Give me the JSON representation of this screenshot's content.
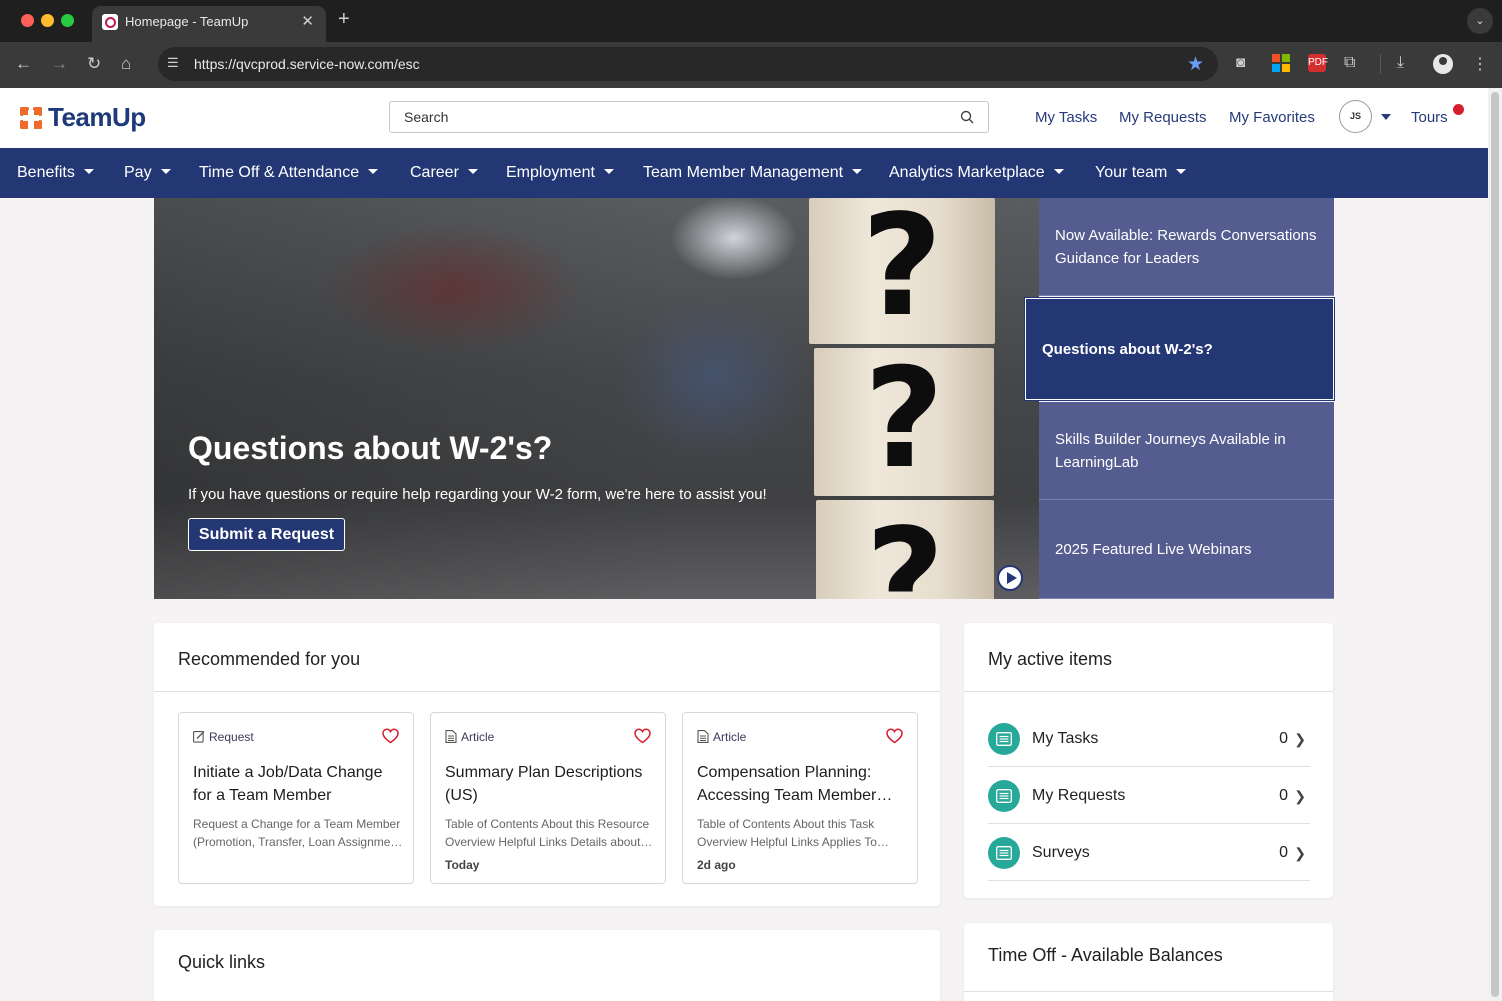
{
  "browser": {
    "tab_title": "Homepage - TeamUp",
    "tab_close": "✕",
    "new_tab": "+",
    "url": "https://qvcprod.service-now.com/esc",
    "pdf_ext_label": "PDF"
  },
  "header": {
    "logo_text": "TeamUp",
    "search_placeholder": "Search",
    "links": {
      "my_tasks": "My Tasks",
      "my_requests": "My Requests",
      "my_favorites": "My Favorites",
      "tours": "Tours"
    },
    "avatar_initials": "JS"
  },
  "nav": {
    "items": [
      "Benefits",
      "Pay",
      "Time Off & Attendance",
      "Career",
      "Employment",
      "Team Member Management",
      "Analytics Marketplace",
      "Your team"
    ]
  },
  "hero": {
    "question_mark": "?",
    "title": "Questions about W-2's?",
    "subtitle": "If you have questions or require help regarding your W-2 form, we're here to assist you!",
    "button_label": "Submit a Request"
  },
  "carousel": {
    "items": [
      "Now Available: Rewards Conversations Guidance for Leaders",
      "Questions about W-2's?",
      "Skills Builder Journeys Available in LearningLab",
      "2025 Featured Live Webinars"
    ],
    "active_index": 1
  },
  "recommended": {
    "title": "Recommended for you",
    "cards": [
      {
        "type": "Request",
        "title": "Initiate a Job/Data Change for a Team Member",
        "desc_line1": "Request a Change for a Team Member",
        "desc_line2": "(Promotion, Transfer, Loan Assignme…",
        "date": ""
      },
      {
        "type": "Article",
        "title": "Summary Plan Descriptions (US)",
        "desc_line1": "Table of Contents About this Resource",
        "desc_line2": "Overview Helpful Links Details about…",
        "date": "Today"
      },
      {
        "type": "Article",
        "title": "Compensation Planning: Accessing Team Member…",
        "desc_line1": "Table of Contents About this Task",
        "desc_line2": "Overview Helpful Links Applies To…",
        "date": "2d ago"
      }
    ]
  },
  "active_items": {
    "title": "My active items",
    "rows": [
      {
        "label": "My Tasks",
        "count": "0"
      },
      {
        "label": "My Requests",
        "count": "0"
      },
      {
        "label": "Surveys",
        "count": "0"
      }
    ]
  },
  "quick_links": {
    "title": "Quick links"
  },
  "time_off": {
    "title": "Time Off - Available Balances"
  },
  "colors": {
    "nav_bg": "#243775",
    "carousel_item_bg": "#555c8f",
    "carousel_active_bg": "#243775",
    "accent_teal": "#27a99a",
    "heart_red": "#d51f30",
    "logo_orange": "#ef6b2a"
  }
}
